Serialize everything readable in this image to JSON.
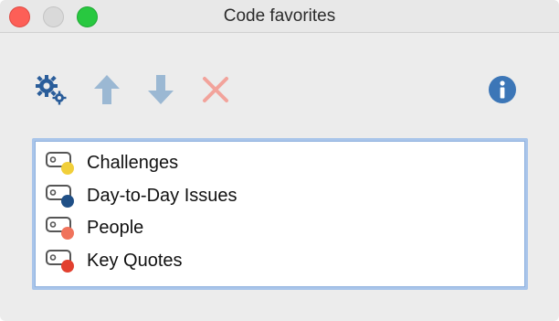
{
  "window": {
    "title": "Code favorites"
  },
  "toolbar": {
    "buttons": [
      {
        "name": "settings",
        "icon": "gears-icon",
        "color": "#2a5d9a"
      },
      {
        "name": "move-up",
        "icon": "arrow-up-icon",
        "color": "#9bb8d3"
      },
      {
        "name": "move-down",
        "icon": "arrow-down-icon",
        "color": "#9bb8d3"
      },
      {
        "name": "delete",
        "icon": "x-icon",
        "color": "#f2a39b"
      },
      {
        "name": "info",
        "icon": "info-icon",
        "color": "#3c76b7"
      }
    ]
  },
  "codes": [
    {
      "label": "Challenges",
      "color": "#f1cf3a"
    },
    {
      "label": "Day-to-Day Issues",
      "color": "#1f4f86"
    },
    {
      "label": "People",
      "color": "#f0735c"
    },
    {
      "label": "Key Quotes",
      "color": "#e2402f"
    }
  ]
}
